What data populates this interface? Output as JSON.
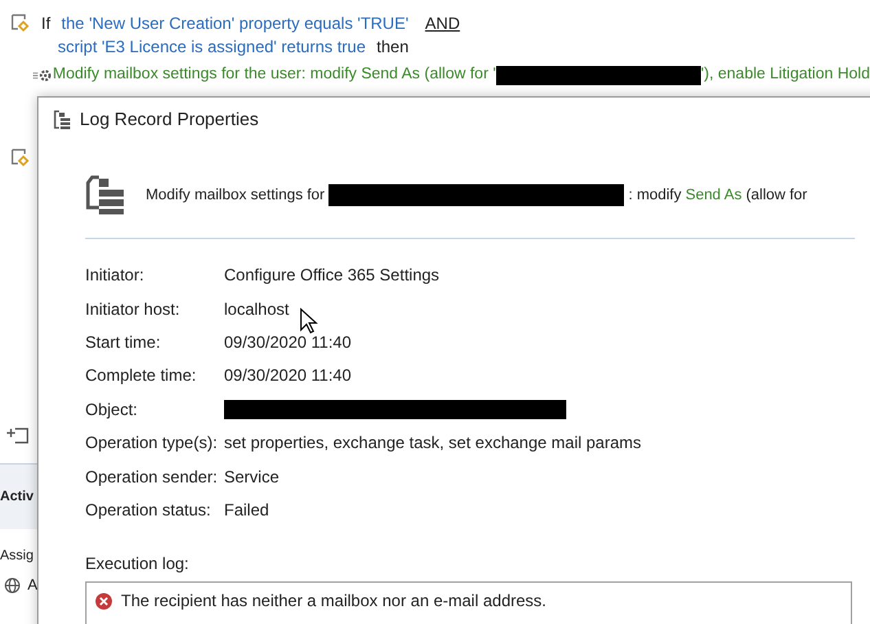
{
  "rule": {
    "keyword": "If",
    "condition_1": "the 'New User Creation' property equals 'TRUE'",
    "operator": "AND",
    "condition_2": "script 'E3 Licence is assigned' returns true",
    "then": "then",
    "action": [
      {
        "kind": "text",
        "text": "Modify mailbox settings for the user: modify Send As (allow for '"
      },
      {
        "kind": "redacted"
      },
      {
        "kind": "text",
        "text": "'), enable Litigation Hold"
      }
    ]
  },
  "side": {
    "heading": "Activ",
    "item": "Assig",
    "item_2": "A"
  },
  "dialog": {
    "title": "Log Record Properties",
    "header": [
      {
        "kind": "text",
        "text": "Modify mailbox settings for"
      },
      {
        "kind": "redacted"
      },
      {
        "kind": "text",
        "text": ": modify"
      },
      {
        "kind": "link",
        "text": "Send As"
      },
      {
        "kind": "text",
        "text": "(allow for"
      }
    ],
    "fields": [
      {
        "label": "Initiator:",
        "kind": "text",
        "value": "Configure Office 365 Settings"
      },
      {
        "label": "Initiator host:",
        "kind": "text",
        "value": "localhost"
      },
      {
        "label": "Start time:",
        "kind": "text",
        "value": "09/30/2020 11:40"
      },
      {
        "label": "Complete time:",
        "kind": "text",
        "value": "09/30/2020 11:40"
      },
      {
        "label": "Object:",
        "kind": "redacted"
      },
      {
        "label": "Operation type(s):",
        "kind": "text",
        "value": "set properties, exchange task, set exchange mail params"
      },
      {
        "label": "Operation sender:",
        "kind": "text",
        "value": "Service"
      },
      {
        "label": "Operation status:",
        "kind": "text",
        "value": "Failed"
      }
    ],
    "log_label": "Execution log:",
    "log": [
      {
        "kind": "error",
        "text": "The recipient has neither a mailbox nor an e-mail address."
      }
    ]
  }
}
